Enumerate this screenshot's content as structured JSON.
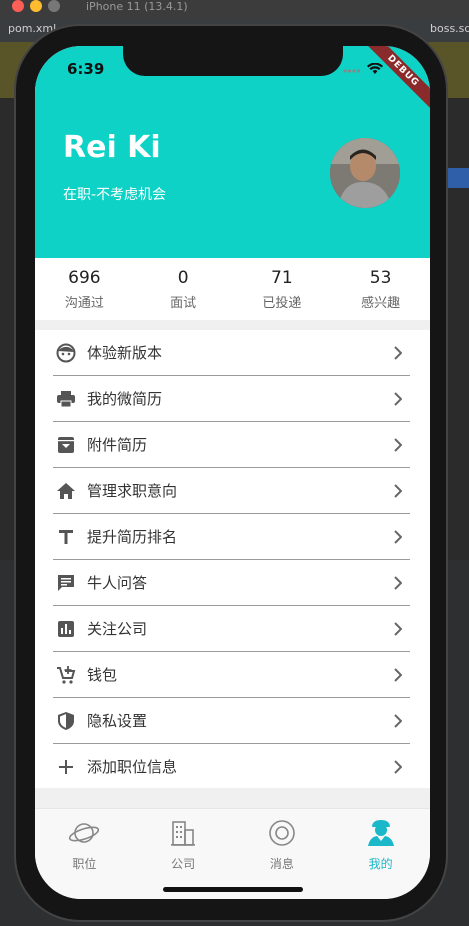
{
  "ide": {
    "tab_left": "pom.xml",
    "tab_right": "boss.sq",
    "window_title": "iPhone 11 (13.4.1)"
  },
  "status_bar": {
    "time": "6:39",
    "debug_label": "DEBUG"
  },
  "profile": {
    "name": "Rei Ki",
    "status": "在职-不考虑机会"
  },
  "stats": [
    {
      "value": "696",
      "label": "沟通过"
    },
    {
      "value": "0",
      "label": "面试"
    },
    {
      "value": "71",
      "label": "已投递"
    },
    {
      "value": "53",
      "label": "感兴趣"
    }
  ],
  "menu": [
    {
      "label": "体验新版本",
      "icon": "face-icon"
    },
    {
      "label": "我的微简历",
      "icon": "printer-icon"
    },
    {
      "label": "附件简历",
      "icon": "archive-icon"
    },
    {
      "label": "管理求职意向",
      "icon": "home-icon"
    },
    {
      "label": "提升简历排名",
      "icon": "text-t-icon"
    },
    {
      "label": "牛人问答",
      "icon": "chat-icon"
    },
    {
      "label": "关注公司",
      "icon": "chart-icon"
    },
    {
      "label": "钱包",
      "icon": "cart-icon"
    },
    {
      "label": "隐私设置",
      "icon": "shield-icon"
    },
    {
      "label": "添加职位信息",
      "icon": "plus-icon"
    }
  ],
  "tabs": [
    {
      "label": "职位",
      "icon": "planet-icon",
      "active": false
    },
    {
      "label": "公司",
      "icon": "building-icon",
      "active": false
    },
    {
      "label": "消息",
      "icon": "at-icon",
      "active": false
    },
    {
      "label": "我的",
      "icon": "person-icon",
      "active": true
    }
  ],
  "colors": {
    "brand": "#0ed2c6",
    "active_tab": "#1ab8c8"
  }
}
